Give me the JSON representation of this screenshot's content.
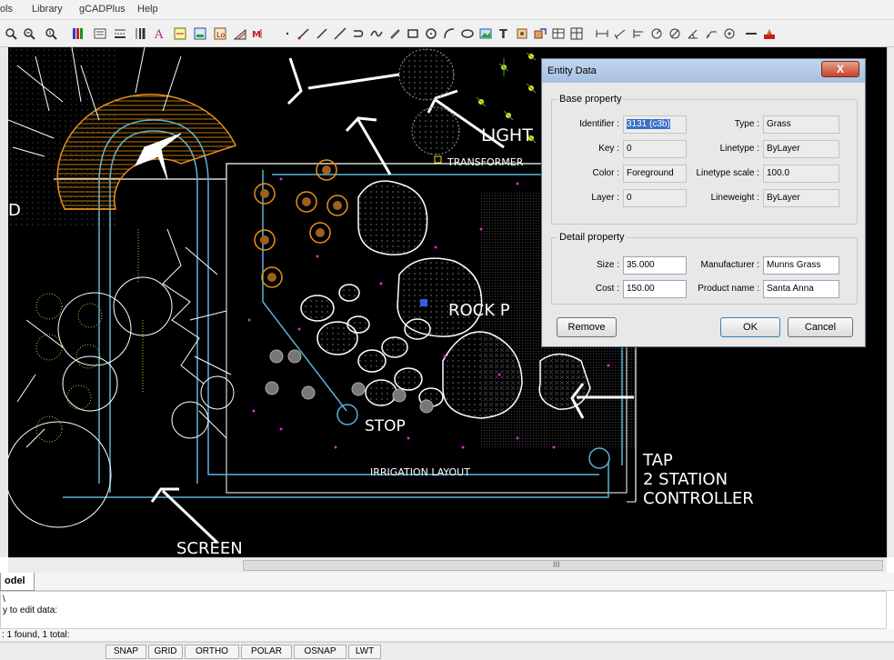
{
  "menu": [
    "ols",
    "Library",
    "gCADPlus",
    "Help"
  ],
  "drawing": {
    "labels": {
      "light": "LIGHT",
      "transformer": "TRANSFORMER",
      "rock": "ROCK  P",
      "stop": "STOP",
      "irrigation": "IRRIGATION  LAYOUT",
      "tap1": "TAP",
      "tap2": "2  STATION",
      "tap3": "CONTROLLER",
      "screen": "SCREEN",
      "left_d": "D"
    }
  },
  "dialog": {
    "title": "Entity Data",
    "close": "X",
    "base_group": "Base property",
    "detail_group": "Detail property",
    "identifier_label": "Identifier :",
    "identifier_value": "3131 (c3b)",
    "key_label": "Key :",
    "key_value": "0",
    "color_label": "Color :",
    "color_value": "Foreground",
    "layer_label": "Layer :",
    "layer_value": "0",
    "type_label": "Type :",
    "type_value": "Grass",
    "linetype_label": "Linetype :",
    "linetype_value": "ByLayer",
    "ltscale_label": "Linetype scale :",
    "ltscale_value": "100.0",
    "lineweight_label": "Lineweight :",
    "lineweight_value": "ByLayer",
    "size_label": "Size :",
    "size_value": "35.000",
    "cost_label": "Cost :",
    "cost_value": "150.00",
    "manufacturer_label": "Manufacturer :",
    "manufacturer_value": "Munns Grass",
    "product_label": "Product name :",
    "product_value": "Santa Anna",
    "remove": "Remove",
    "ok": "OK",
    "cancel": "Cancel"
  },
  "tabs": {
    "model": "odel"
  },
  "command": {
    "line1": "\\",
    "line2": "y to edit data:",
    "prompt": ": 1 found, 1 total:"
  },
  "status": [
    "SNAP",
    "GRID",
    "ORTHO",
    "POLAR",
    "OSNAP",
    "LWT"
  ],
  "hscroll_grip": "III",
  "colors": {
    "canvas": "#000000",
    "plan_line": "#5ab2d8",
    "tree_orange": "#e8921a",
    "magenta_dots": "#d22cd2",
    "palm_yellow": "#f0e020"
  }
}
